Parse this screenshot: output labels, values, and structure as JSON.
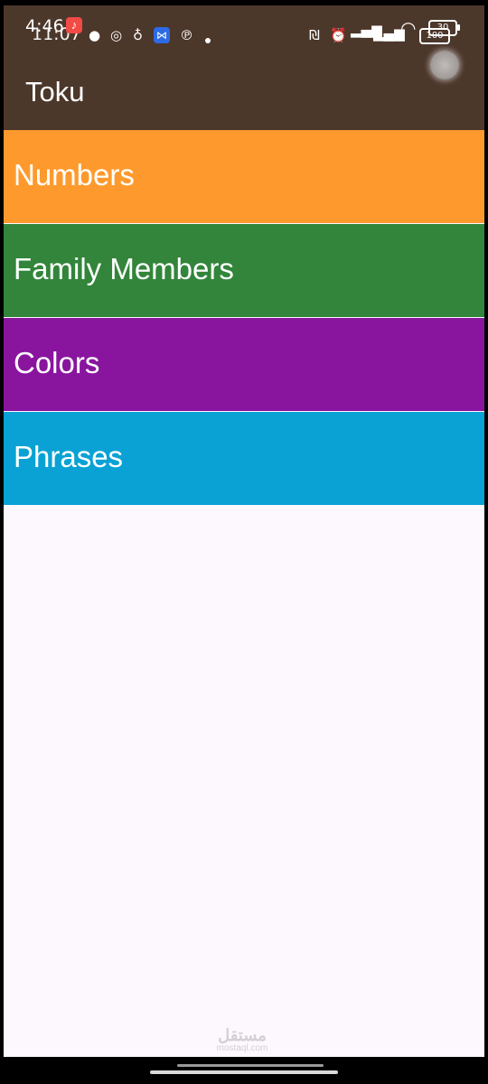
{
  "status_bar": {
    "time_primary": "4:46",
    "time_secondary": "11:07",
    "battery_primary": "30",
    "battery_secondary": "100",
    "icons": [
      "music-notification-icon",
      "chat-bubble-icon",
      "instagram-icon",
      "lamp-icon",
      "shareit-icon",
      "pinterest-icon",
      "more-dot-icon",
      "nfc-icon",
      "alarm-icon",
      "signal-icon",
      "signal-icon",
      "wifi-icon",
      "battery-icon"
    ]
  },
  "app_bar": {
    "title": "Toku"
  },
  "categories": [
    {
      "label": "Numbers",
      "color": "#fe9a2d"
    },
    {
      "label": "Family Members",
      "color": "#32853a"
    },
    {
      "label": "Colors",
      "color": "#89159f"
    },
    {
      "label": "Phrases",
      "color": "#0aa2d4"
    }
  ],
  "watermark": {
    "text": "مستقل",
    "subtext": "mostaql.com"
  },
  "colors": {
    "app_bar": "#4c372b",
    "background": "#fcf8fd"
  }
}
